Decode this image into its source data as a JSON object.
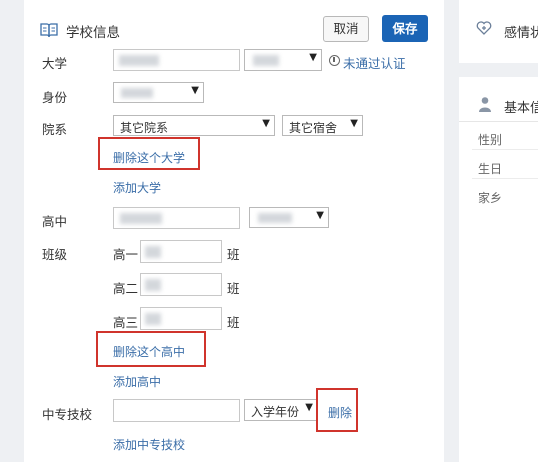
{
  "school_info": {
    "title": "学校信息",
    "cancel_label": "取消",
    "save_label": "保存",
    "university": {
      "label": "大学",
      "unverified": "未通过认证"
    },
    "identity": {
      "label": "身份"
    },
    "department": {
      "label": "院系",
      "dept_value": "其它院系",
      "dorm_value": "其它宿舍",
      "delete_label": "删除这个大学",
      "add_label": "添加大学"
    },
    "high_school": {
      "label": "高中",
      "delete_label": "删除这个高中",
      "add_label": "添加高中"
    },
    "classes": {
      "label": "班级",
      "rows": [
        {
          "grade": "高一",
          "suffix": "班"
        },
        {
          "grade": "高二",
          "suffix": "班"
        },
        {
          "grade": "高三",
          "suffix": "班"
        }
      ]
    },
    "vocational": {
      "label": "中专技校",
      "year_placeholder": "入学年份",
      "delete_label": "删除",
      "add_label": "添加中专技校"
    }
  },
  "right_panel": {
    "emotion_title": "感情状",
    "basic_title": "基本信",
    "fields": [
      "性别",
      "生日",
      "家乡"
    ]
  },
  "colors": {
    "accent": "#1b64b5",
    "link": "#3b6ea8",
    "highlight": "#d0342c"
  }
}
